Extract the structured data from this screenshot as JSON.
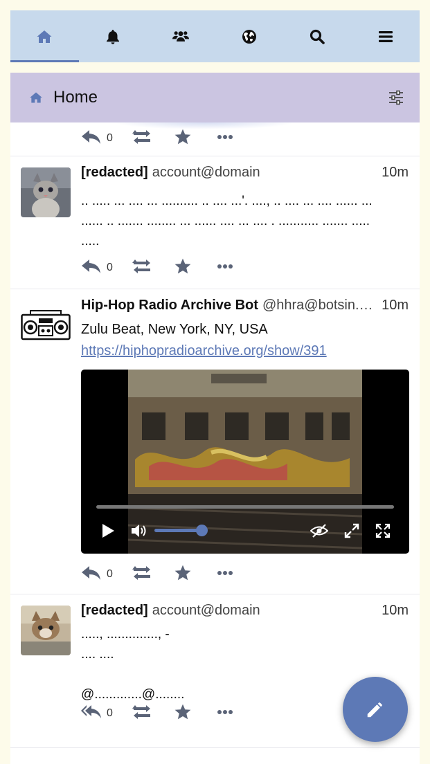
{
  "nav": {
    "tabs": [
      {
        "name": "home",
        "icon": "home-icon",
        "active": true
      },
      {
        "name": "notifications",
        "icon": "bell-icon",
        "active": false
      },
      {
        "name": "community",
        "icon": "users-icon",
        "active": false
      },
      {
        "name": "federated",
        "icon": "globe-icon",
        "active": false
      },
      {
        "name": "search",
        "icon": "search-icon",
        "active": false
      },
      {
        "name": "menu",
        "icon": "menu-icon",
        "active": false
      }
    ]
  },
  "header": {
    "title": "Home",
    "icon": "home-icon",
    "filter_icon": "sliders-icon"
  },
  "colors": {
    "nav_bg": "#c7d9ec",
    "header_bg": "#cbc5e1",
    "accent": "#5d79b6",
    "page_bg": "#fdfbea"
  },
  "statuses": [
    {
      "partial": true,
      "reply_count": "0"
    },
    {
      "display_name": "[redacted]",
      "account": "account@domain",
      "time": "10m",
      "avatar": "cat-photo",
      "lines": [
        ".. ..... ... .... ... .......... .. .... ...'. ....,  .. .... ... .... ...... ...",
        "...... .. ....... ........ ... ...... .... ... .... . ........... ....... .....",
        "....."
      ],
      "reply_count": "0"
    },
    {
      "display_name": "Hip-Hop Radio Archive Bot",
      "account": "@hhra@botsin.…",
      "time": "10m",
      "avatar": "boombox-icon",
      "lines": [
        "Zulu Beat, New York, NY, USA"
      ],
      "link": "https://hiphopradioarchive.org/show/391",
      "video": {
        "progress": 0,
        "volume": 0.75
      },
      "reply_count": "0"
    },
    {
      "display_name": "[redacted]",
      "account": "account@domain",
      "time": "10m",
      "avatar": "kitten-photo",
      "lines": [
        ".....,  ..............,  -",
        ".... ....",
        "",
        "@.............@........"
      ],
      "reply_count": "0",
      "reply_all": true
    }
  ],
  "compose_button": {
    "icon": "pencil-icon"
  }
}
